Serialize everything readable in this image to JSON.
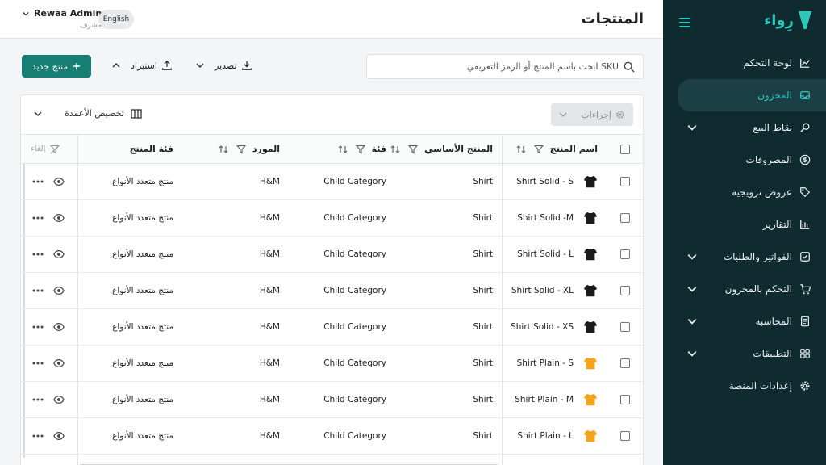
{
  "app": {
    "logo_text": "رِواء",
    "accent": "#2ec6bd",
    "primary": "#167e72"
  },
  "sidebar": {
    "items": [
      {
        "label": "لوحة التحكم",
        "icon": "chart-line-icon",
        "expandable": false,
        "active": false
      },
      {
        "label": "المخزون",
        "icon": "inbox-icon",
        "expandable": false,
        "active": true
      },
      {
        "label": "نقاط البيع",
        "icon": "magnifier-icon",
        "expandable": true,
        "active": false
      },
      {
        "label": "المصروفات",
        "icon": "dollar-circle-icon",
        "expandable": false,
        "active": false
      },
      {
        "label": "عروض ترويجية",
        "icon": "tag-icon",
        "expandable": false,
        "active": false
      },
      {
        "label": "التقارير",
        "icon": "bar-chart-icon",
        "expandable": false,
        "active": false
      },
      {
        "label": "الفواتير والطلبات",
        "icon": "checkbox-icon",
        "expandable": true,
        "active": false
      },
      {
        "label": "التحكم بالمخزون",
        "icon": "cart-icon",
        "expandable": true,
        "active": false
      },
      {
        "label": "المحاسبة",
        "icon": "ledger-icon",
        "expandable": true,
        "active": false
      },
      {
        "label": "التطبيقات",
        "icon": "grid-icon",
        "expandable": true,
        "active": false
      },
      {
        "label": "إعدادات المنصة",
        "icon": "gear-icon",
        "expandable": false,
        "active": false
      }
    ]
  },
  "header": {
    "title": "المنتجات",
    "user_name": "Rewaa Admin",
    "user_role": "مشرف",
    "language": "English"
  },
  "toolbar": {
    "search_placeholder": "ابحث باسم المنتج أو الرمز التعريفي SKU",
    "export_label": "تصدير",
    "import_label": "استيراد",
    "new_product_label": "منتج جديد"
  },
  "table": {
    "actions_label": "إجراءات",
    "customize_label": "تخصيص الأعمدة",
    "columns": {
      "name": "اسم المنتج",
      "base": "المنتج الأساسي",
      "category": "فئة",
      "supplier": "المورد",
      "product_category": "فئة المنتج",
      "cancel": "إلغاء"
    },
    "rows": [
      {
        "name": "Shirt Solid - S",
        "base": "Shirt",
        "category": "Child Category",
        "supplier": "H&M",
        "product_category": "منتج متعدد الأنواع",
        "color": "#1a1a1a"
      },
      {
        "name": "Shirt Solid -M",
        "base": "Shirt",
        "category": "Child Category",
        "supplier": "H&M",
        "product_category": "منتج متعدد الأنواع",
        "color": "#1a1a1a"
      },
      {
        "name": "Shirt Solid - L",
        "base": "Shirt",
        "category": "Child Category",
        "supplier": "H&M",
        "product_category": "منتج متعدد الأنواع",
        "color": "#1a1a1a"
      },
      {
        "name": "Shirt Solid - XL",
        "base": "Shirt",
        "category": "Child Category",
        "supplier": "H&M",
        "product_category": "منتج متعدد الأنواع",
        "color": "#1a1a1a"
      },
      {
        "name": "Shirt Solid - XS",
        "base": "Shirt",
        "category": "Child Category",
        "supplier": "H&M",
        "product_category": "منتج متعدد الأنواع",
        "color": "#1a1a1a"
      },
      {
        "name": "Shirt Plain - S",
        "base": "Shirt",
        "category": "Child Category",
        "supplier": "H&M",
        "product_category": "منتج متعدد الأنواع",
        "color": "#f2a51a"
      },
      {
        "name": "Shirt Plain - M",
        "base": "Shirt",
        "category": "Child Category",
        "supplier": "H&M",
        "product_category": "منتج متعدد الأنواع",
        "color": "#f2a51a"
      },
      {
        "name": "Shirt Plain - L",
        "base": "Shirt",
        "category": "Child Category",
        "supplier": "H&M",
        "product_category": "منتج متعدد الأنواع",
        "color": "#f2a51a"
      }
    ]
  }
}
